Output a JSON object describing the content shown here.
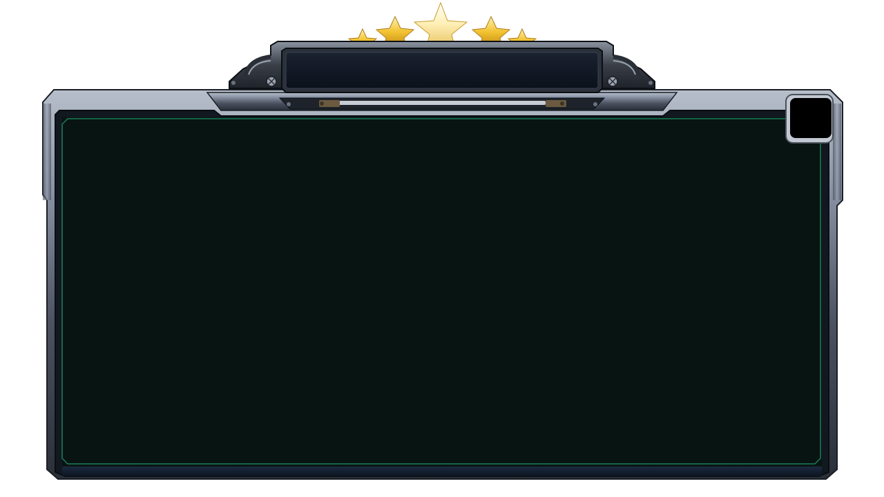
{
  "dialog": {
    "title": "",
    "stars_shown": 5,
    "close_label": ""
  },
  "colors": {
    "frame_steel": "#8a94a6",
    "frame_dark": "#1c222c",
    "panel_bg": "#081412",
    "panel_border": "#1f8a64",
    "star_gold": "#f2c230",
    "title_plate": "#121824",
    "close_bg": "#000000"
  },
  "icons": {
    "stars": "star-rating-icon",
    "screws": "screw-icon",
    "close": "close-icon"
  }
}
